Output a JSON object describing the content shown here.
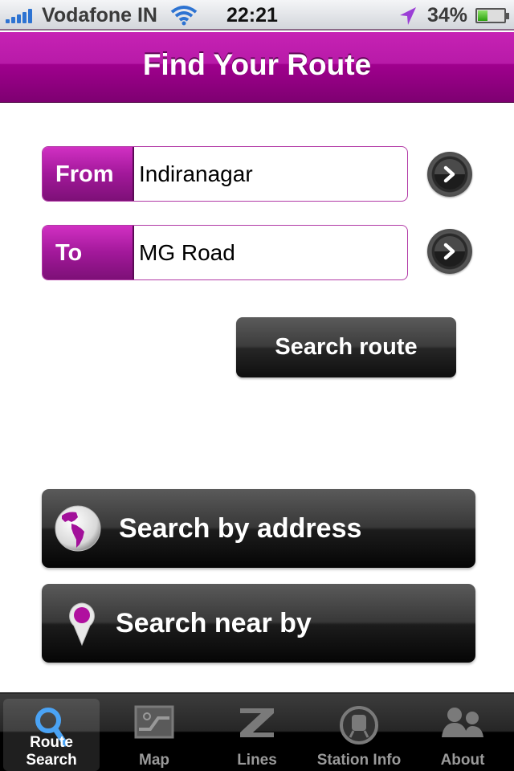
{
  "status_bar": {
    "carrier": "Vodafone IN",
    "time": "22:21",
    "battery_percent": "34%",
    "battery_level": 0.34,
    "signal_icon": "signal-bars-icon",
    "wifi_icon": "wifi-icon",
    "location_icon": "location-arrow-icon"
  },
  "nav": {
    "title": "Find Your Route"
  },
  "route_form": {
    "from_label": "From",
    "from_value": "Indiranagar",
    "to_label": "To",
    "to_value": "MG Road",
    "search_button": "Search route"
  },
  "actions": {
    "search_by_address": "Search by address",
    "search_near_by": "Search near by"
  },
  "tabbar": {
    "tabs": [
      {
        "label": "Route Search",
        "icon": "magnifier-icon",
        "active": true
      },
      {
        "label": "Map",
        "icon": "map-icon",
        "active": false
      },
      {
        "label": "Lines",
        "icon": "lines-icon",
        "active": false
      },
      {
        "label": "Station Info",
        "icon": "train-icon",
        "active": false
      },
      {
        "label": "About",
        "icon": "people-icon",
        "active": false
      }
    ]
  },
  "colors": {
    "brand_magenta": "#a0008e",
    "tab_active_icon": "#4aa3f5",
    "text_on_dark": "#ffffff"
  }
}
